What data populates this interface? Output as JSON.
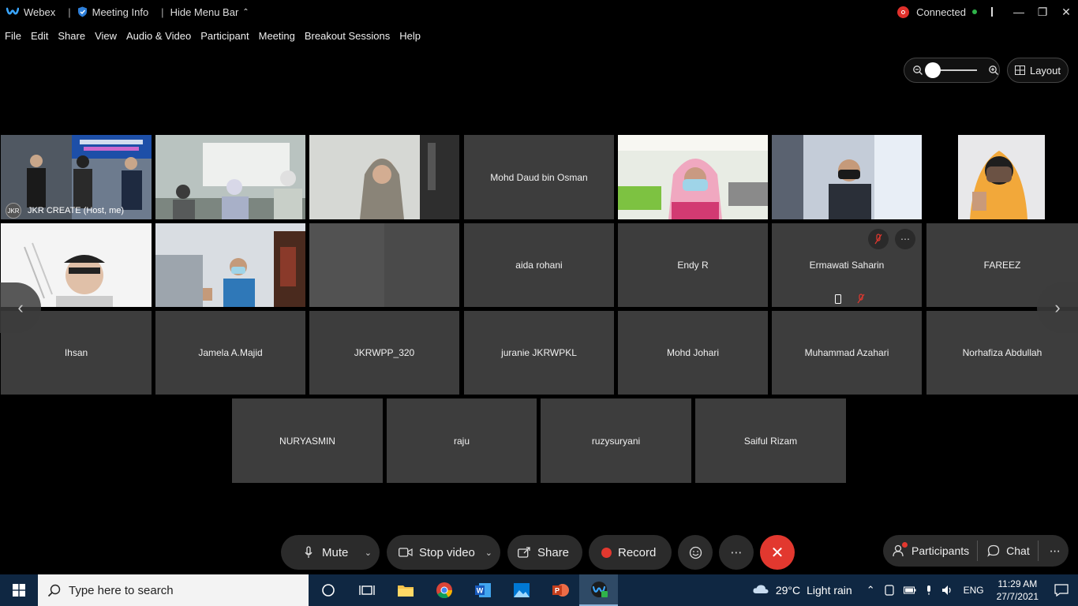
{
  "titlebar": {
    "app_name": "Webex",
    "meeting_info": "Meeting Info",
    "hide_menu": "Hide Menu Bar",
    "connection": "Connected"
  },
  "menu": {
    "items": [
      "File",
      "Edit",
      "Share",
      "View",
      "Audio & Video",
      "Participant",
      "Meeting",
      "Breakout Sessions",
      "Help"
    ]
  },
  "view_controls": {
    "layout_label": "Layout",
    "zoom_level": 0.0
  },
  "participants": {
    "host": "JKR CREATE  (Host, me)",
    "mohd_daud": "Mohd Daud bin Osman",
    "aida": "aida rohani",
    "endy": "Endy R",
    "ermawati": "Ermawati Saharin",
    "fareez": "FAREEZ",
    "ihsan": "Ihsan",
    "jamela": "Jamela A.Majid",
    "jkrwpp": "JKRWPP_320",
    "juranie": "juranie JKRWPKL",
    "mohd_johari": "Mohd Johari",
    "azahari": "Muhammad Azahari",
    "norhafiza": "Norhafiza Abdullah",
    "nuryasmin": "NURYASMIN",
    "raju": "raju",
    "ruzy": "ruzysuryani",
    "saiful": "Saiful Rizam"
  },
  "controls": {
    "mute": "Mute",
    "stop_video": "Stop video",
    "share": "Share",
    "record": "Record",
    "participants": "Participants",
    "chat": "Chat"
  },
  "taskbar": {
    "search_placeholder": "Type here to search",
    "weather_temp": "29°C",
    "weather_desc": "Light rain",
    "lang": "ENG",
    "time": "11:29 AM",
    "date": "27/7/2021"
  }
}
